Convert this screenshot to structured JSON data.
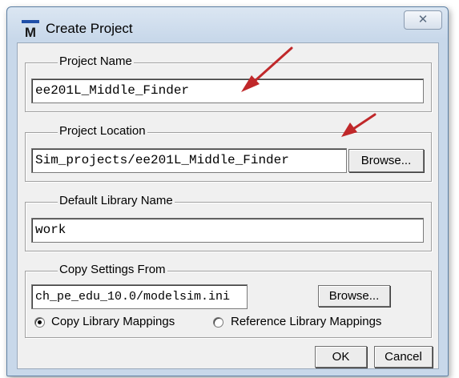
{
  "window": {
    "title": "Create Project",
    "close_glyph": "✕"
  },
  "project_name": {
    "legend": "Project Name",
    "value": "ee201L_Middle_Finder"
  },
  "project_location": {
    "legend": "Project Location",
    "value": "Sim_projects/ee201L_Middle_Finder",
    "browse_label": "Browse..."
  },
  "default_library": {
    "legend": "Default Library Name",
    "value": "work"
  },
  "copy_settings": {
    "legend": "Copy Settings From",
    "value": "ch_pe_edu_10.0/modelsim.ini",
    "browse_label": "Browse...",
    "options": [
      {
        "label": "Copy Library Mappings",
        "selected": true
      },
      {
        "label": "Reference Library Mappings",
        "selected": false
      }
    ]
  },
  "footer": {
    "ok_label": "OK",
    "cancel_label": "Cancel"
  },
  "annotation_color": "#c0282a"
}
